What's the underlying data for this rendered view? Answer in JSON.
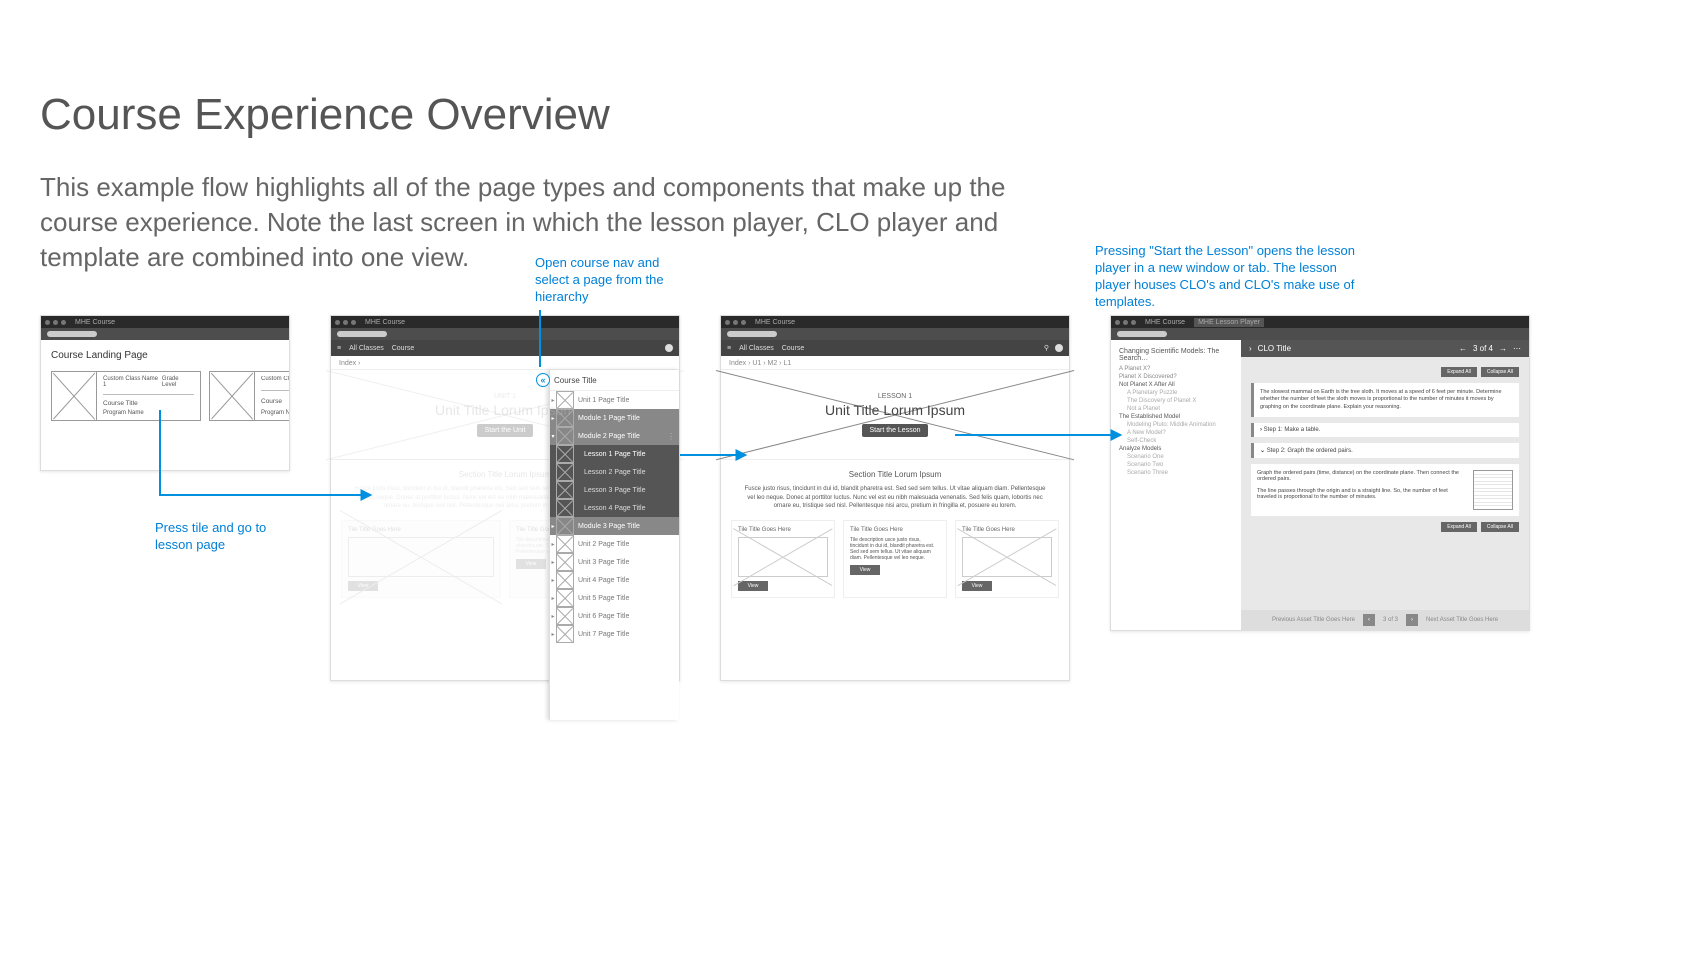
{
  "page": {
    "title": "Course Experience Overview",
    "intro": "This example flow highlights all of the page types and components that make up the course experience. Note the last screen in which the lesson player, CLO player and template are combined into one view."
  },
  "annotations": {
    "a1": "Press tile and go to lesson page",
    "a2": "Open course nav and select a page from the hierarchy",
    "a3": "Pressing \"Start the Lesson\" opens the lesson player in a new window or tab. The lesson player houses CLO's and CLO's make use of templates."
  },
  "browser_tab": "MHE Course",
  "browser_tab_player": "MHE Lesson Player",
  "appbar": {
    "left": "All Classes",
    "mid": "Course"
  },
  "panel1": {
    "heading": "Course Landing Page",
    "card": {
      "className": "Custom Class Name 1",
      "grade": "Grade Level",
      "course": "Course Title",
      "program": "Program Name"
    }
  },
  "panel2": {
    "breadcrumb": "Index  ›",
    "kicker": "UNIT 1",
    "heroTitle": "Unit Title Lorum Ipsum",
    "heroBtn": "Start the Unit",
    "section": "Section Title Lorum Ipsum",
    "lorem": "Fusce justo risus, tincidunt in dui id, blandit pharetra est. Sed sed sem tellus. Ut vitae aliquam diam. Pellentesque vel leo neque. Donec at porttitor luctus. Nunc vel est eu nibh malesuada venenatis. Sed felis quam, lobortis nec ornare eu, tristique sed nisl. Pellentesque nisi arcu, pretium in fringilla et, posuere eu lorem.",
    "tile": "Tile Title Goes Here",
    "view": "View",
    "drawerTitle": "Course Title",
    "drawer": [
      {
        "style": "light",
        "label": "Unit 1 Page Title",
        "caret": "▸"
      },
      {
        "style": "mod",
        "label": "Module 1 Page Title",
        "caret": "▸"
      },
      {
        "style": "mod",
        "label": "Module 2 Page Title",
        "caret": "▾",
        "dots": "⋮"
      },
      {
        "style": "dark active",
        "label": "Lesson 1 Page Title"
      },
      {
        "style": "dark",
        "label": "Lesson 2 Page Title"
      },
      {
        "style": "dark",
        "label": "Lesson 3 Page Title"
      },
      {
        "style": "dark",
        "label": "Lesson 4 Page Title"
      },
      {
        "style": "mod",
        "label": "Module 3 Page Title",
        "caret": "▸"
      },
      {
        "style": "light",
        "label": "Unit 2 Page Title",
        "caret": "▸"
      },
      {
        "style": "light",
        "label": "Unit 3 Page Title",
        "caret": "▸"
      },
      {
        "style": "light",
        "label": "Unit 4 Page Title",
        "caret": "▸"
      },
      {
        "style": "light",
        "label": "Unit 5 Page Title",
        "caret": "▸"
      },
      {
        "style": "light",
        "label": "Unit 6 Page Title",
        "caret": "▸"
      },
      {
        "style": "light",
        "label": "Unit 7 Page Title",
        "caret": "▸"
      }
    ]
  },
  "panel3": {
    "breadcrumb": "Index  ›  U1  ›  M2  ›  L1",
    "kicker": "LESSON 1",
    "heroTitle": "Unit Title Lorum Ipsum",
    "heroBtn": "Start the Lesson",
    "section": "Section Title Lorum Ipsum",
    "lorem": "Fusce justo risus, tincidunt in dui id, blandit pharetra est. Sed sed sem tellus. Ut vitae aliquam diam. Pellentesque vel leo neque. Donec at porttitor luctus. Nunc vel est eu nibh malesuada venenatis. Sed felis quam, lobortis nec ornare eu, tristique sed nisl. Pellentesque nisi arcu, pretium in fringilla et, posuere eu lorem.",
    "tile1": "Tile Title Goes Here",
    "tile2": "Tile Title Goes Here",
    "tile3": "Tile Title Goes Here",
    "tile2desc": "Tile description usce justo risus, tincidunt in dui id, blandit pharetra est. Sed sed sem tellus. Ut vitae aliquam diam. Pellentesque vel leo neque.",
    "view": "View"
  },
  "panel4": {
    "cloTitle": "CLO Title",
    "cloPage": "3 of 4",
    "side": {
      "heading": "Changing Scientific Models: The Search…",
      "items": [
        {
          "t": "A Planet X?",
          "sub": false
        },
        {
          "t": "Planet X Discovered?",
          "sub": false
        },
        {
          "t": "Not Planet X After All",
          "sub": false,
          "bold": true
        },
        {
          "t": "A Planetary Puzzle",
          "sub": true
        },
        {
          "t": "The Discovery of Planet X",
          "sub": true
        },
        {
          "t": "Not a Planet",
          "sub": true
        },
        {
          "t": "The Established Model",
          "sub": false,
          "bold": true
        },
        {
          "t": "Modeling Pluto: Middle Animation",
          "sub": true
        },
        {
          "t": "A New Model?",
          "sub": true
        },
        {
          "t": "Self-Check",
          "sub": true
        },
        {
          "t": "Analyze Models",
          "sub": false,
          "bold": true
        },
        {
          "t": "Scenario One",
          "sub": true
        },
        {
          "t": "Scenario Two",
          "sub": true
        },
        {
          "t": "Scenario Three",
          "sub": true
        }
      ]
    },
    "expand": "Expand All",
    "collapse": "Collapse All",
    "problem": "The slowest mammal on Earth is the tree sloth. It moves at a speed of 6 feet per minute. Determine whether the number of feet the sloth moves is proportional to the number of minutes it moves by graphing on the coordinate plane. Explain your reasoning.",
    "step1": "Step 1: Make a table.",
    "step2": "Step 2: Graph the ordered pairs.",
    "step2body": "Graph the ordered pairs (time, distance) on the coordinate plane. Then connect the ordered pairs.",
    "step2note": "The line passes through the origin and is a straight line. So, the number of feet traveled is proportional to the number of minutes.",
    "pagerPrev": "Previous Asset Title Goes Here",
    "pagerMid": "3   of   3",
    "pagerNext": "Next Asset Title Goes Here"
  }
}
